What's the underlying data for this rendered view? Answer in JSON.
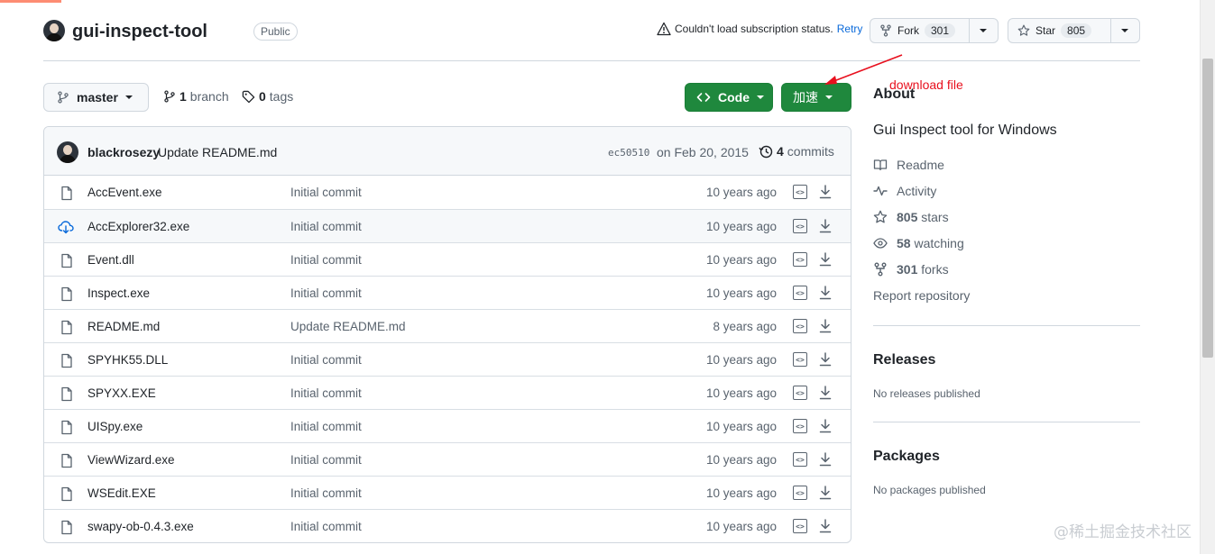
{
  "repo": {
    "name": "gui-inspect-tool",
    "visibility": "Public",
    "subscription_warning": "Couldn't load subscription status.",
    "retry_label": "Retry",
    "fork_label": "Fork",
    "fork_count": "301",
    "star_label": "Star",
    "star_count": "805"
  },
  "toolbar": {
    "branch": "master",
    "branches_count": "1",
    "branches_label": "branch",
    "tags_count": "0",
    "tags_label": "tags",
    "code_label": "Code",
    "accel_label": "加速"
  },
  "annotation": {
    "text": "download file",
    "color": "#e8101e"
  },
  "latest_commit": {
    "user": "blackrosezy",
    "message": "Update README.md",
    "sha": "ec50510",
    "date": "on Feb 20, 2015",
    "count": "4",
    "count_label": "commits"
  },
  "files": [
    {
      "name": "AccEvent.exe",
      "message": "Initial commit",
      "age": "10 years ago",
      "icon": "file-icon"
    },
    {
      "name": "AccExplorer32.exe",
      "message": "Initial commit",
      "age": "10 years ago",
      "icon": "cloud-download-icon"
    },
    {
      "name": "Event.dll",
      "message": "Initial commit",
      "age": "10 years ago",
      "icon": "file-icon"
    },
    {
      "name": "Inspect.exe",
      "message": "Initial commit",
      "age": "10 years ago",
      "icon": "file-icon"
    },
    {
      "name": "README.md",
      "message": "Update README.md",
      "age": "8 years ago",
      "icon": "file-icon"
    },
    {
      "name": "SPYHK55.DLL",
      "message": "Initial commit",
      "age": "10 years ago",
      "icon": "file-icon"
    },
    {
      "name": "SPYXX.EXE",
      "message": "Initial commit",
      "age": "10 years ago",
      "icon": "file-icon"
    },
    {
      "name": "UISpy.exe",
      "message": "Initial commit",
      "age": "10 years ago",
      "icon": "file-icon"
    },
    {
      "name": "ViewWizard.exe",
      "message": "Initial commit",
      "age": "10 years ago",
      "icon": "file-icon"
    },
    {
      "name": "WSEdit.EXE",
      "message": "Initial commit",
      "age": "10 years ago",
      "icon": "file-icon"
    },
    {
      "name": "swapy-ob-0.4.3.exe",
      "message": "Initial commit",
      "age": "10 years ago",
      "icon": "file-icon"
    }
  ],
  "about": {
    "heading": "About",
    "description": "Gui Inspect tool for Windows",
    "readme": "Readme",
    "activity": "Activity",
    "stars_count": "805",
    "stars_label": "stars",
    "watching_count": "58",
    "watching_label": "watching",
    "forks_count": "301",
    "forks_label": "forks",
    "report": "Report repository"
  },
  "releases": {
    "heading": "Releases",
    "empty": "No releases published"
  },
  "packages": {
    "heading": "Packages",
    "empty": "No packages published"
  },
  "watermark": "@稀土掘金技术社区",
  "colors": {
    "primary_button": "#1f883d",
    "link": "#0969da",
    "muted": "#59636e",
    "border": "#d0d7de"
  }
}
